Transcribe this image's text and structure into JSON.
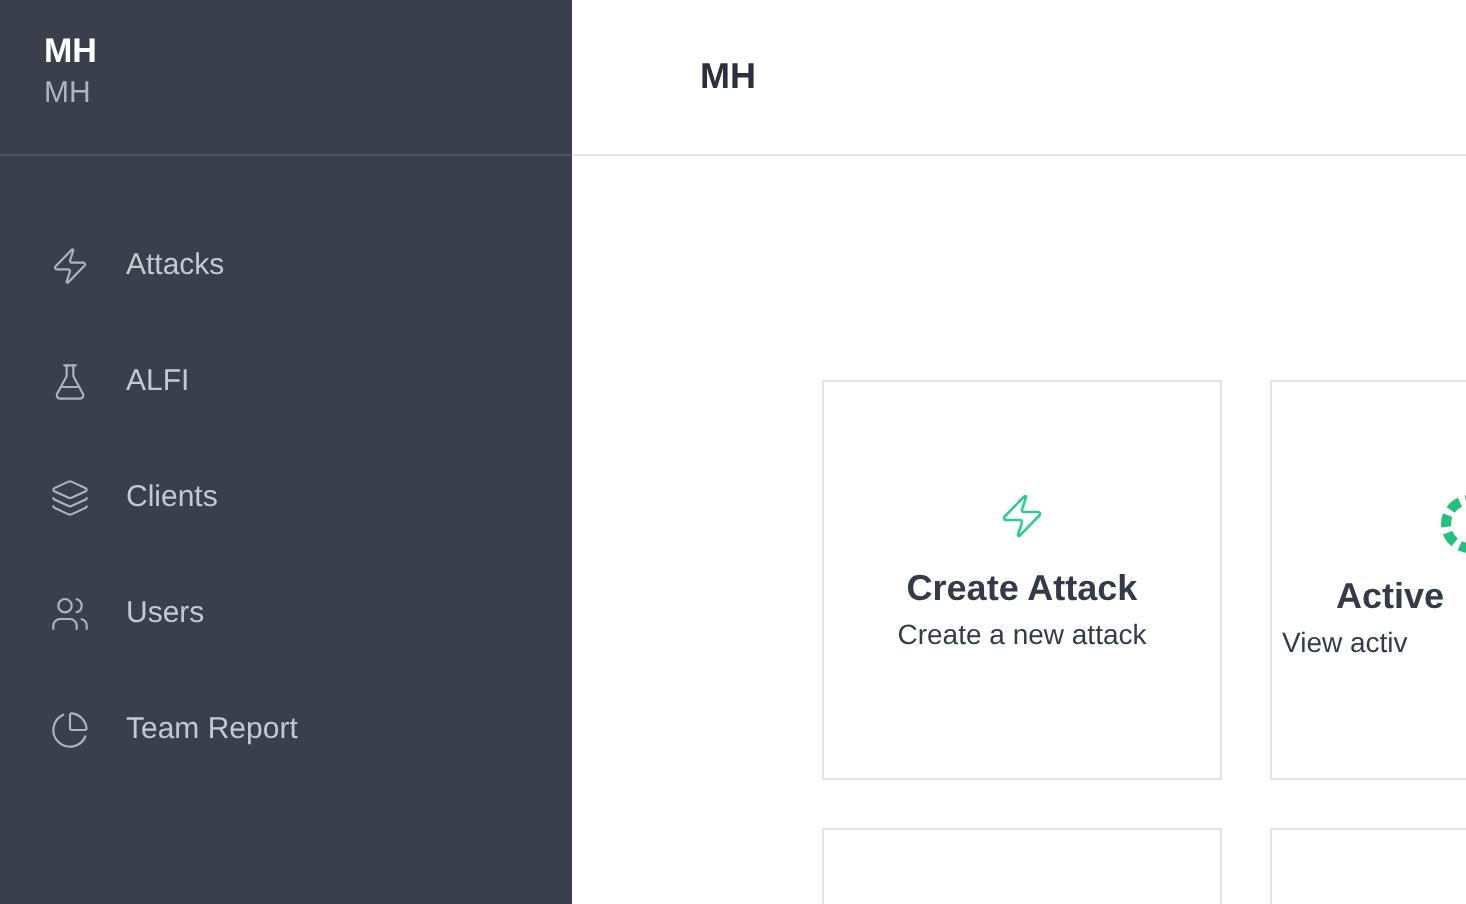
{
  "sidebar": {
    "title": "MH",
    "subtitle": "MH",
    "items": [
      {
        "label": "Attacks"
      },
      {
        "label": "ALFI"
      },
      {
        "label": "Clients"
      },
      {
        "label": "Users"
      },
      {
        "label": "Team Report"
      }
    ]
  },
  "header": {
    "title": "MH"
  },
  "cards": [
    {
      "kind": "full",
      "title": "Create Attack",
      "description": "Create a new attack"
    },
    {
      "kind": "cut",
      "title": "Active",
      "description": "View activ"
    },
    {
      "kind": "empty"
    },
    {
      "kind": "empty"
    }
  ]
}
